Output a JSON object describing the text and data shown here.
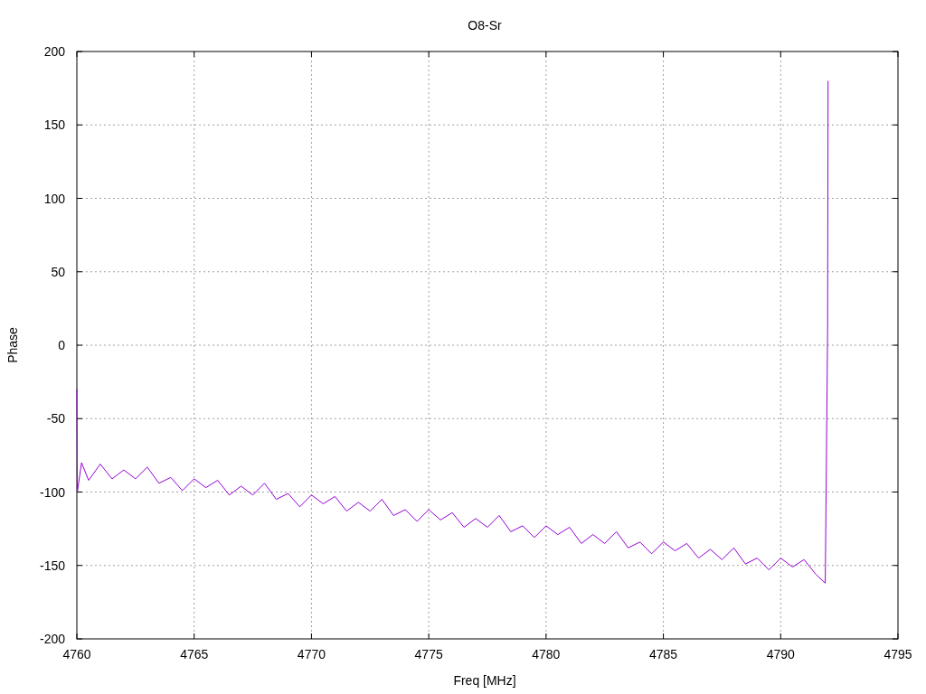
{
  "chart_data": {
    "type": "line",
    "title": "O8-Sr",
    "xlabel": "Freq [MHz]",
    "ylabel": "Phase",
    "grid": true,
    "xlim": [
      4760,
      4795
    ],
    "ylim": [
      -200,
      200
    ],
    "xticks": [
      4760,
      4765,
      4770,
      4775,
      4780,
      4785,
      4790,
      4795
    ],
    "yticks": [
      -200,
      -150,
      -100,
      -50,
      0,
      50,
      100,
      150,
      200
    ],
    "x": [
      4760,
      4760.02,
      4760.2,
      4760.5,
      4761,
      4761.5,
      4762,
      4762.5,
      4763,
      4763.5,
      4764,
      4764.5,
      4765,
      4765.5,
      4766,
      4766.5,
      4767,
      4767.5,
      4768,
      4768.5,
      4769,
      4769.5,
      4770,
      4770.5,
      4771,
      4771.5,
      4772,
      4772.5,
      4773,
      4773.5,
      4774,
      4774.5,
      4775,
      4775.5,
      4776,
      4776.5,
      4777,
      4777.5,
      4778,
      4778.5,
      4779,
      4779.5,
      4780,
      4780.5,
      4781,
      4781.5,
      4782,
      4782.5,
      4783,
      4783.5,
      4784,
      4784.5,
      4785,
      4785.5,
      4786,
      4786.5,
      4787,
      4787.5,
      4788,
      4788.5,
      4789,
      4789.5,
      4790,
      4790.5,
      4791,
      4791.5,
      4791.9,
      4792,
      4792.02
    ],
    "series": [
      {
        "color": "#9400d3",
        "values": [
          -30,
          -100,
          -80,
          -92,
          -81,
          -91,
          -85,
          -91,
          -83,
          -94,
          -90,
          -99,
          -91,
          -97,
          -92,
          -102,
          -96,
          -102,
          -94,
          -105,
          -101,
          -110,
          -102,
          -108,
          -103,
          -113,
          -107,
          -113,
          -105,
          -116,
          -112,
          -120,
          -112,
          -119,
          -114,
          -124,
          -118,
          -124,
          -116,
          -127,
          -123,
          -131,
          -123,
          -129,
          -124,
          -135,
          -129,
          -135,
          -127,
          -138,
          -134,
          -142,
          -134,
          -140,
          -135,
          -145,
          -139,
          -146,
          -138,
          -149,
          -145,
          -153,
          -145,
          -151,
          -146,
          -156,
          -162,
          10,
          180
        ]
      }
    ]
  }
}
